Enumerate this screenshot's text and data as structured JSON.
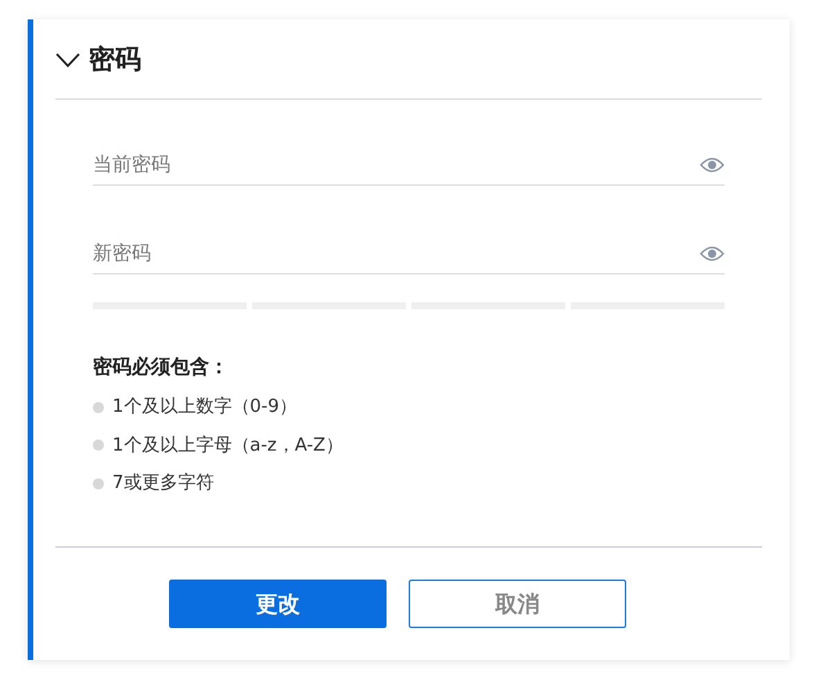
{
  "section": {
    "title": "密码",
    "expanded": true
  },
  "fields": [
    {
      "placeholder": "当前密码"
    },
    {
      "placeholder": "新密码"
    }
  ],
  "requirements": {
    "title": "密码必须包含：",
    "items": [
      {
        "text": "1个及以上数字（0-9）",
        "met": false
      },
      {
        "text": "1个及以上字母（a-z，A-Z）",
        "met": false
      },
      {
        "text": "7或更多字符",
        "met": false
      }
    ]
  },
  "buttons": [
    {
      "label": "更改",
      "kind": "primary"
    },
    {
      "label": "取消",
      "kind": "secondary"
    }
  ]
}
